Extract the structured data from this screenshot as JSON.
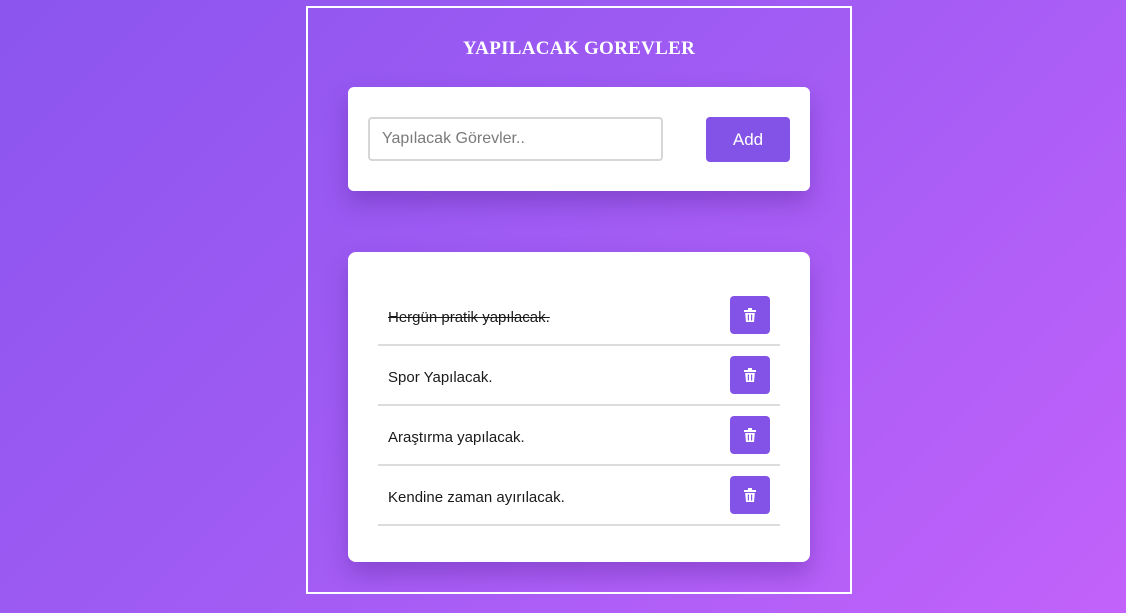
{
  "app": {
    "title": "YAPILACAK GOREVLER"
  },
  "input_section": {
    "input_placeholder": "Yapılacak Görevler..",
    "input_value": "",
    "add_label": "Add"
  },
  "tasks": [
    {
      "text": "Hergün pratik yapılacak.",
      "completed": true,
      "delete_icon": "trash-icon"
    },
    {
      "text": "Spor Yapılacak.",
      "completed": false,
      "delete_icon": "trash-icon"
    },
    {
      "text": "Araştırma yapılacak.",
      "completed": false,
      "delete_icon": "trash-icon"
    },
    {
      "text": "Kendine zaman ayırılacak.",
      "completed": false,
      "delete_icon": "trash-icon"
    }
  ],
  "colors": {
    "accent": "#8353e8",
    "background_start": "#8b55ee",
    "background_end": "#c262fb"
  }
}
